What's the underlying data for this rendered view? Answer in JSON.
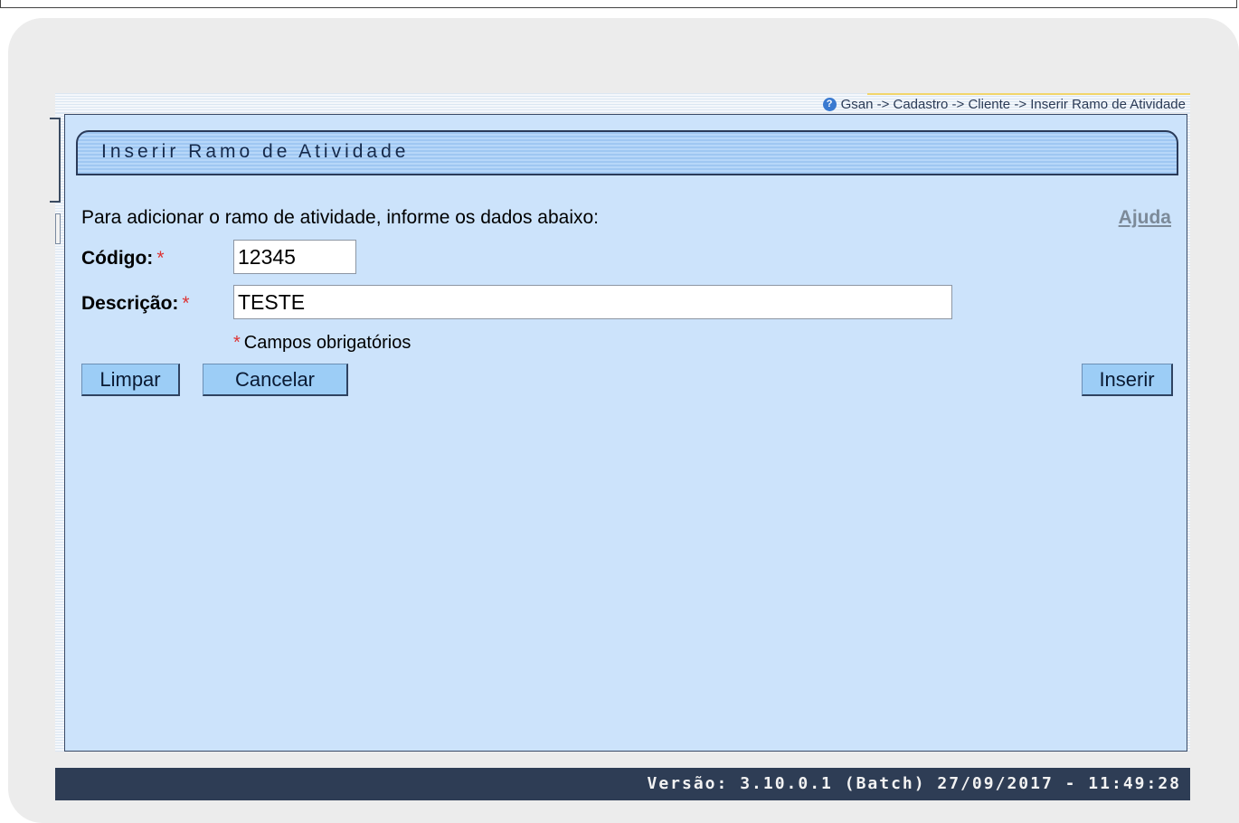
{
  "breadcrumb": "Gsan -> Cadastro -> Cliente -> Inserir Ramo de Atividade",
  "page_title": "Inserir Ramo de Atividade",
  "instruction": "Para adicionar o ramo de atividade, informe os dados abaixo:",
  "help_link": "Ajuda",
  "form": {
    "codigo": {
      "label": "Código:",
      "required_marker": "*",
      "value": "12345"
    },
    "descricao": {
      "label": "Descrição:",
      "required_marker": "*",
      "value": "TESTE"
    },
    "required_note_marker": "*",
    "required_note": "Campos obrigatórios"
  },
  "buttons": {
    "limpar": "Limpar",
    "cancelar": "Cancelar",
    "inserir": "Inserir"
  },
  "footer": {
    "version": "Versão: 3.10.0.1 (Batch) 27/09/2017 - 11:49:28"
  },
  "colors": {
    "panel_bg": "#cce3fb",
    "footer_bg": "#2e3d55",
    "button_bg": "#9ccdf6",
    "required_marker": "#dd3333"
  }
}
